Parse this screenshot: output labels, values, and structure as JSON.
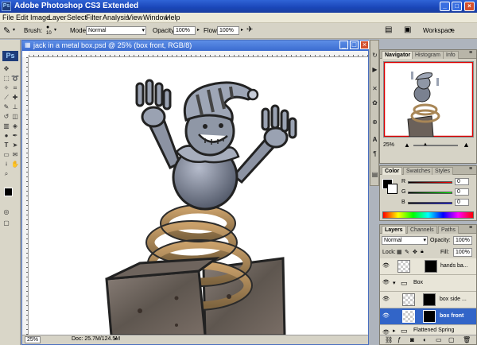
{
  "window": {
    "title": "Adobe Photoshop CS3 Extended",
    "app_icon": "Ps"
  },
  "menu": {
    "items": [
      "File",
      "Edit",
      "Image",
      "Layer",
      "Select",
      "Filter",
      "Analysis",
      "View",
      "Window",
      "Help"
    ]
  },
  "options_bar": {
    "brush_label": "Brush:",
    "brush_size": "10",
    "mode_label": "Mode:",
    "mode_value": "Normal",
    "opacity_label": "Opacity:",
    "opacity_value": "100%",
    "flow_label": "Flow:",
    "flow_value": "100%",
    "workspace_label": "Workspace"
  },
  "toolbox": {
    "logo": "Ps"
  },
  "document": {
    "title": "jack in a metal box.psd @ 25% (box front, RGB/8)",
    "zoom": "25%",
    "doc_size": "Doc: 25.7M/124.5M"
  },
  "navigator": {
    "tabs": [
      "Navigator",
      "Histogram",
      "Info"
    ],
    "zoom": "25%"
  },
  "color_panel": {
    "tabs": [
      "Color",
      "Swatches",
      "Styles"
    ],
    "channels": [
      {
        "label": "R",
        "value": "0"
      },
      {
        "label": "G",
        "value": "0"
      },
      {
        "label": "B",
        "value": "0"
      }
    ]
  },
  "layers_panel": {
    "tabs": [
      "Layers",
      "Channels",
      "Paths"
    ],
    "blend_mode": "Normal",
    "opacity_label": "Opacity:",
    "opacity_value": "100%",
    "lock_label": "Lock:",
    "fill_label": "Fill:",
    "fill_value": "100%",
    "layers": [
      {
        "name": "hands ba..."
      },
      {
        "name": "Box"
      },
      {
        "name": "box side ..."
      },
      {
        "name": "box front"
      },
      {
        "name": "Flattened Spring"
      }
    ]
  },
  "colors": {
    "titlebar": "#2453c7",
    "selection": "#3265c8",
    "accent_red": "#d4502e"
  }
}
